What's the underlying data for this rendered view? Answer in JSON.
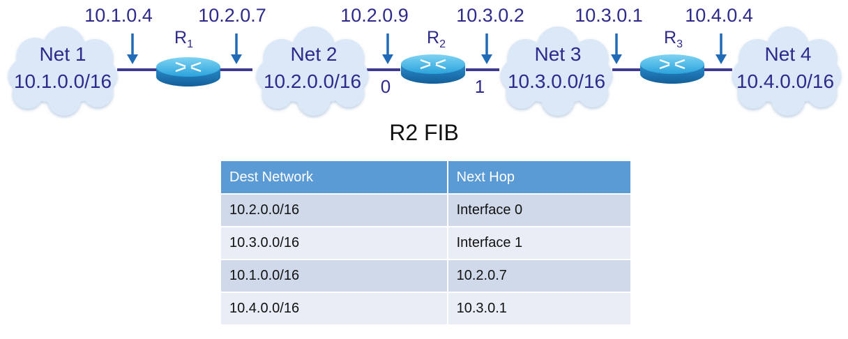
{
  "networks": [
    {
      "name": "Net 1",
      "cidr": "10.1.0.0/16"
    },
    {
      "name": "Net 2",
      "cidr": "10.2.0.0/16"
    },
    {
      "name": "Net 3",
      "cidr": "10.3.0.0/16"
    },
    {
      "name": "Net 4",
      "cidr": "10.4.0.0/16"
    }
  ],
  "routers": [
    {
      "name": "R",
      "sub": "1"
    },
    {
      "name": "R",
      "sub": "2"
    },
    {
      "name": "R",
      "sub": "3"
    }
  ],
  "ip_labels": [
    "10.1.0.4",
    "10.2.0.7",
    "10.2.0.9",
    "10.3.0.2",
    "10.3.0.1",
    "10.4.0.4"
  ],
  "ports": [
    "0",
    "1"
  ],
  "fib": {
    "title": "R2 FIB",
    "headers": [
      "Dest Network",
      "Next Hop"
    ],
    "rows": [
      [
        "10.2.0.0/16",
        "Interface 0"
      ],
      [
        "10.3.0.0/16",
        "Interface 1"
      ],
      [
        "10.1.0.0/16",
        "10.2.0.7"
      ],
      [
        "10.4.0.0/16",
        "10.3.0.1"
      ]
    ]
  },
  "colors": {
    "label": "#2d2a8c",
    "cloud": "#dbe8f7",
    "link": "#3f3a8f",
    "arrow": "#1f6bb7",
    "router_top": "#3ab6e6",
    "router_side": "#1a78b8",
    "header": "#5b9bd5"
  }
}
